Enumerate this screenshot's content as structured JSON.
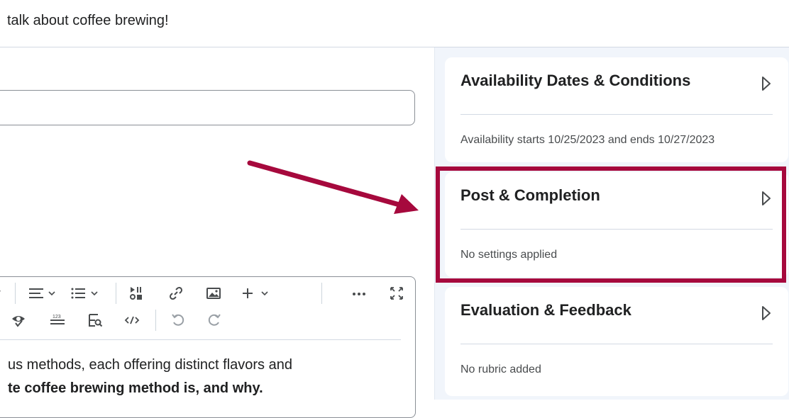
{
  "header": {
    "title": "talk about coffee brewing!"
  },
  "editor": {
    "line1": "us methods, each offering distinct flavors and",
    "line2": "te coffee brewing method is, and why.",
    "toolbar": {
      "row1": [
        "chevron-down-icon",
        "align-icon",
        "list-icon",
        "insert-stuff-icon",
        "link-icon",
        "image-icon",
        "plus-icon",
        "more-icon",
        "fullscreen-icon"
      ],
      "row2": [
        "accessibility-check-icon",
        "word-count-icon",
        "preview-icon",
        "source-code-icon",
        "undo-icon",
        "redo-icon"
      ]
    }
  },
  "panels": [
    {
      "title": "Availability Dates & Conditions",
      "summary": "Availability starts 10/25/2023 and ends 10/27/2023"
    },
    {
      "title": "Post & Completion",
      "summary": "No settings applied"
    },
    {
      "title": "Evaluation & Feedback",
      "summary": "No rubric added"
    }
  ],
  "annotation": {
    "highlight_color": "#a6093d",
    "arrow_color": "#a6093d"
  }
}
